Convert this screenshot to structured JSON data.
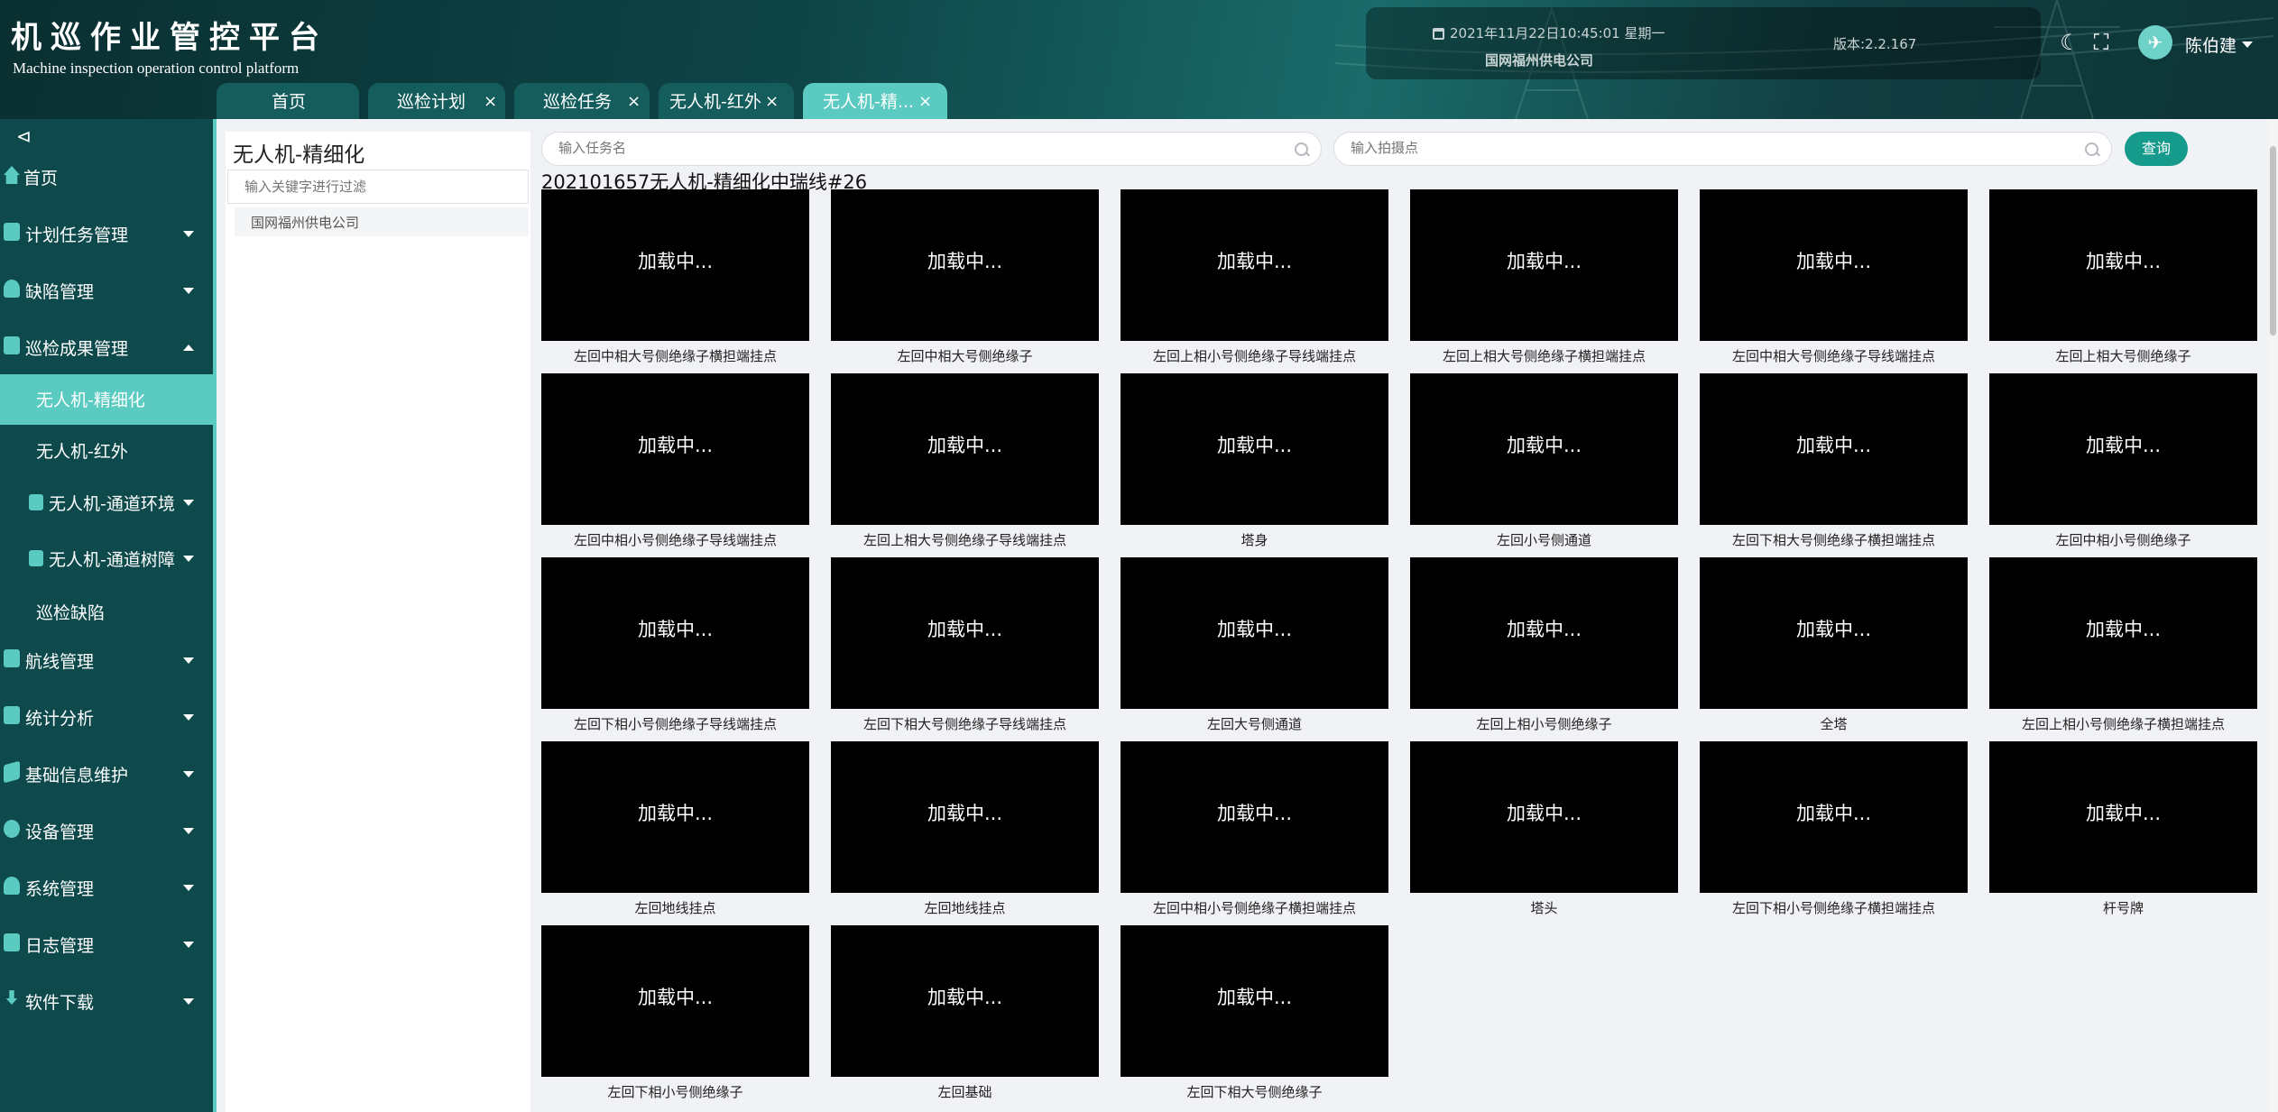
{
  "header": {
    "title": "机巡作业管控平台",
    "subtitle": "Machine inspection operation control platform",
    "datetime": "2021年11月22日10:45:01 星期一",
    "company": "国网福州供电公司",
    "version": "版本:2.2.167",
    "user": "陈伯建",
    "icons": [
      "theme-toggle-icon",
      "fullscreen-icon",
      "user-avatar-icon"
    ]
  },
  "tabs": [
    {
      "label": "首页",
      "closable": false
    },
    {
      "label": "巡检计划",
      "closable": true
    },
    {
      "label": "巡检任务",
      "closable": true
    },
    {
      "label": "无人机-红外",
      "closable": true
    },
    {
      "label": "无人机-精...",
      "closable": true,
      "active": true
    }
  ],
  "tab_close_glyph": "×",
  "sidebar": {
    "collapse_glyph": "⊲",
    "items": [
      {
        "label": "首页"
      },
      {
        "label": "计划任务管理"
      },
      {
        "label": "缺陷管理"
      },
      {
        "label": "巡检成果管理",
        "expanded": true
      },
      {
        "label": "无人机-精细化",
        "sub": true,
        "active": true
      },
      {
        "label": "无人机-红外",
        "sub": true
      },
      {
        "label": "无人机-通道环境",
        "sub": true
      },
      {
        "label": "无人机-通道树障",
        "sub": true
      },
      {
        "label": "巡检缺陷",
        "sub": true
      },
      {
        "label": "航线管理"
      },
      {
        "label": "统计分析"
      },
      {
        "label": "基础信息维护"
      },
      {
        "label": "设备管理"
      },
      {
        "label": "系统管理"
      },
      {
        "label": "日志管理"
      },
      {
        "label": "软件下载"
      }
    ]
  },
  "tree_panel": {
    "title": "无人机-精细化",
    "filter_placeholder": "输入关键字进行过滤",
    "node": "国网福州供电公司"
  },
  "search": {
    "task_placeholder": "输入任务名",
    "point_placeholder": "输入拍摄点",
    "query_label": "查询"
  },
  "task_title": "202101657无人机-精细化中瑞线#26",
  "loading_text": "加载中...",
  "photos": [
    "左回中相大号侧绝缘子横担端挂点",
    "左回中相大号侧绝缘子",
    "左回上相小号侧绝缘子导线端挂点",
    "左回上相大号侧绝缘子横担端挂点",
    "左回中相大号侧绝缘子导线端挂点",
    "左回上相大号侧绝缘子",
    "左回中相小号侧绝缘子导线端挂点",
    "左回上相大号侧绝缘子导线端挂点",
    "塔身",
    "左回小号侧通道",
    "左回下相大号侧绝缘子横担端挂点",
    "左回中相小号侧绝缘子",
    "左回下相小号侧绝缘子导线端挂点",
    "左回下相大号侧绝缘子导线端挂点",
    "左回大号侧通道",
    "左回上相小号侧绝缘子",
    "全塔",
    "左回上相小号侧绝缘子横担端挂点",
    "左回地线挂点",
    "左回地线挂点",
    "左回中相小号侧绝缘子横担端挂点",
    "塔头",
    "左回下相小号侧绝缘子横担端挂点",
    "杆号牌",
    "左回下相小号侧绝缘子",
    "左回基础",
    "左回下相大号侧绝缘子"
  ]
}
